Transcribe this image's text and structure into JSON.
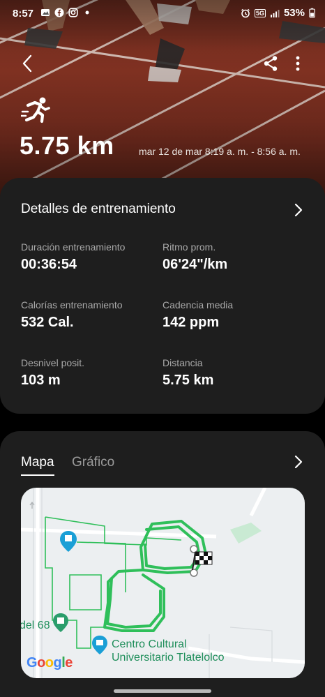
{
  "status_bar": {
    "time": "8:57",
    "battery": "53%",
    "network": "5G"
  },
  "header": {
    "distance": "5.75 km",
    "date_range": "mar 12 de mar 8:19 a. m. - 8:56 a. m.",
    "icons": [
      "back-icon",
      "share-icon",
      "more-icon",
      "running-icon"
    ]
  },
  "details": {
    "title": "Detalles de entrenamiento",
    "stats": [
      {
        "label": "Duración entrenamiento",
        "value": "00:36:54"
      },
      {
        "label": "Ritmo prom.",
        "value": "06'24\"/km"
      },
      {
        "label": "Calorías entrenamiento",
        "value": "532 Cal."
      },
      {
        "label": "Cadencia media",
        "value": "142 ppm"
      },
      {
        "label": "Desnivel posit.",
        "value": "103 m"
      },
      {
        "label": "Distancia",
        "value": "5.75 km"
      }
    ]
  },
  "map_card": {
    "tabs": [
      {
        "label": "Mapa",
        "active": true
      },
      {
        "label": "Gráfico",
        "active": false
      }
    ],
    "map_labels": {
      "road": "del 68",
      "place": "Centro Cultural Universitario Tlatelolco"
    },
    "google": "Google",
    "route_color": "#2fbf5a"
  }
}
